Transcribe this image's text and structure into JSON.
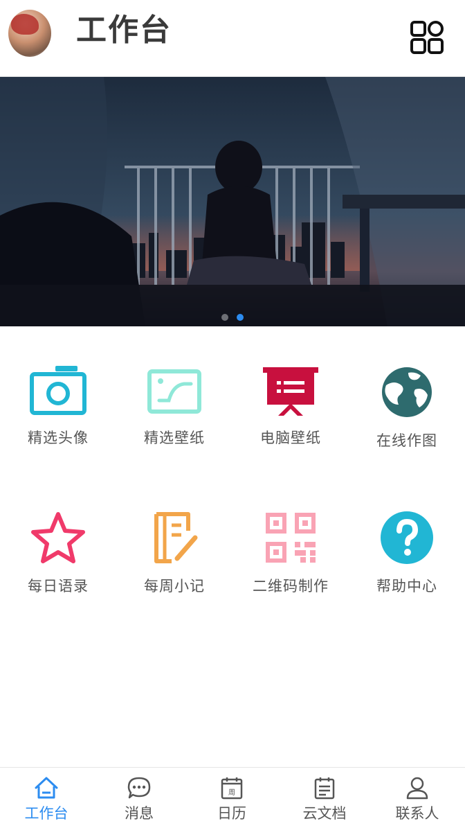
{
  "header": {
    "title": "工作台",
    "avatar_icon": "avatar-user",
    "grid_icon": "grid-apps-icon"
  },
  "banner": {
    "slide_count": 2,
    "active_index": 1
  },
  "apps": [
    {
      "label": "精选头像",
      "icon": "camera-icon",
      "color": "#21b6d4"
    },
    {
      "label": "精选壁纸",
      "icon": "image-frame-icon",
      "color": "#8fe8d8"
    },
    {
      "label": "电脑壁纸",
      "icon": "presentation-board-icon",
      "color": "#c8103e"
    },
    {
      "label": "在线作图",
      "icon": "globe-icon",
      "color": "#2e6b6e"
    },
    {
      "label": "每日语录",
      "icon": "star-icon",
      "color": "#f03a6a"
    },
    {
      "label": "每周小记",
      "icon": "notebook-pen-icon",
      "color": "#f2a54a"
    },
    {
      "label": "二维码制作",
      "icon": "qr-code-icon",
      "color": "#f9a3b4"
    },
    {
      "label": "帮助中心",
      "icon": "help-question-icon",
      "color": "#21b6d4"
    }
  ],
  "tabbar": {
    "active_color": "#2c8cf0",
    "items": [
      {
        "label": "工作台",
        "icon": "home-icon",
        "active": true
      },
      {
        "label": "消息",
        "icon": "chat-bubble-icon",
        "active": false
      },
      {
        "label": "日历",
        "icon": "calendar-week-icon",
        "active": false,
        "icon_text": "周"
      },
      {
        "label": "云文档",
        "icon": "document-icon",
        "active": false
      },
      {
        "label": "联系人",
        "icon": "contact-person-icon",
        "active": false
      }
    ]
  }
}
